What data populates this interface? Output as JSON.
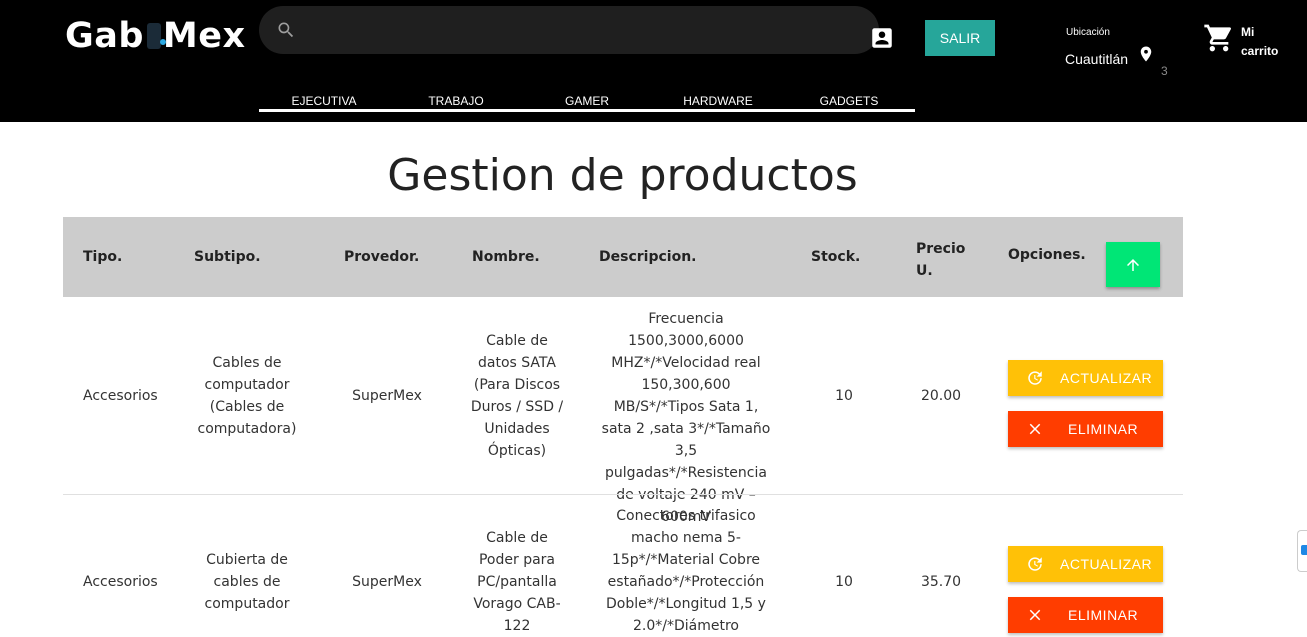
{
  "header": {
    "logo_left": "Gab",
    "logo_right": "Mex",
    "search_placeholder": "",
    "logout_label": "SALIR",
    "location_label": "Ubicación",
    "location_city": "Cuautitlán",
    "location_count": "3",
    "cart_label": "Mi carrito",
    "icons": [
      "search-icon",
      "account-box-icon",
      "location-pin-icon",
      "shopping-cart-icon"
    ]
  },
  "categories": [
    "EJECUTIVA",
    "TRABAJO",
    "GAMER",
    "HARDWARE",
    "GADGETS"
  ],
  "page_title": "Gestion de productos",
  "table": {
    "headers": {
      "tipo": "Tipo.",
      "subtipo": "Subtipo.",
      "proveedor": "Provedor.",
      "nombre": "Nombre.",
      "descripcion": "Descripcion.",
      "stock": "Stock.",
      "precio": "Precio U.",
      "opciones": "Opciones."
    },
    "update_label": "ACTUALIZAR",
    "delete_label": "ELIMINAR",
    "rows": [
      {
        "tipo": "Accesorios",
        "subtipo": "Cables de computador (Cables de computadora)",
        "proveedor": "SuperMex",
        "nombre": "Cable de datos SATA (Para Discos Duros / SSD / Unidades Ópticas)",
        "descripcion": "Frecuencia 1500,3000,6000 MHZ*/*Velocidad real 150,300,600 MB/S*/*Tipos Sata 1, sata 2 ,sata 3*/*Tamaño 3,5 pulgadas*/*Resistencia de voltaje 240 mV – 600mV",
        "stock": "10",
        "precio": "20.00"
      },
      {
        "tipo": "Accesorios",
        "subtipo": "Cubierta de cables de computador",
        "proveedor": "SuperMex",
        "nombre": "Cable de Poder para PC/pantalla Vorago CAB-122",
        "descripcion": "Conectores trifasico macho nema 5-15p*/*Material Cobre estañado*/*Protección Doble*/*Longitud 1,5 y 2.0*/*Diámetro",
        "stock": "10",
        "precio": "35.70"
      }
    ]
  },
  "colors": {
    "topbar": "#000000",
    "salir": "#26a69a",
    "header_row": "#cccccc",
    "up_button": "#00e676",
    "update_button": "#ffc107",
    "delete_button": "#ff3d00"
  }
}
